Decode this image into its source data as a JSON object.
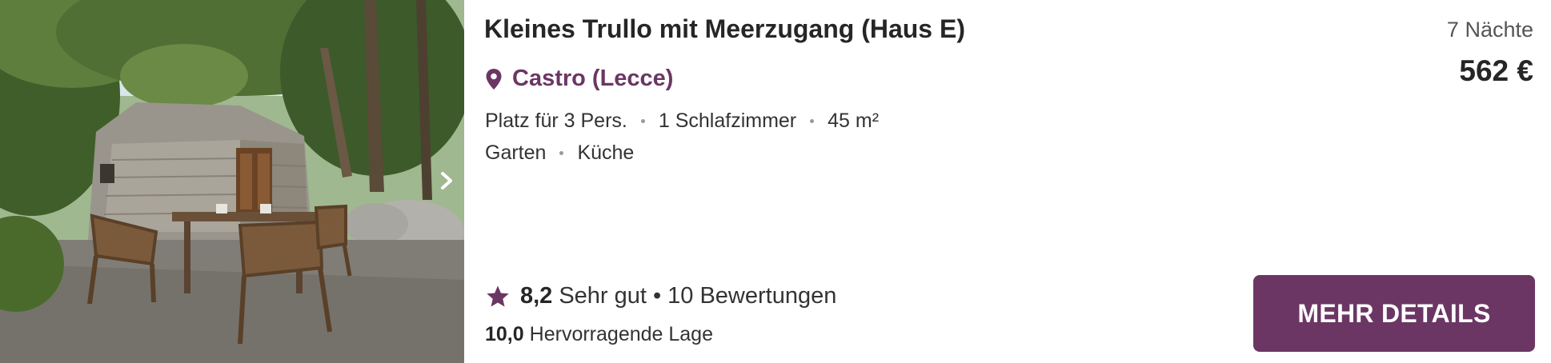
{
  "listing": {
    "title": "Kleines Trullo mit Meerzugang (Haus E)",
    "location": "Castro (Lecce)",
    "features_row1": [
      "Platz für 3 Pers.",
      "1 Schlafzimmer",
      "45 m²"
    ],
    "features_row2": [
      "Garten",
      "Küche"
    ],
    "rating": {
      "score": "8,2",
      "verdict": "Sehr gut",
      "separator": "•",
      "reviews": "10 Bewertungen"
    },
    "location_rating": {
      "score": "10,0",
      "label": "Hervorragende Lage"
    },
    "nights": "7 Nächte",
    "price": "562 €",
    "details_button": "MEHR DETAILS"
  },
  "icons": {
    "location": "map-pin-icon",
    "rating": "star-icon",
    "gallery_next": "chevron-right-icon"
  },
  "colors": {
    "accent": "#6b3664",
    "text": "#262626"
  }
}
